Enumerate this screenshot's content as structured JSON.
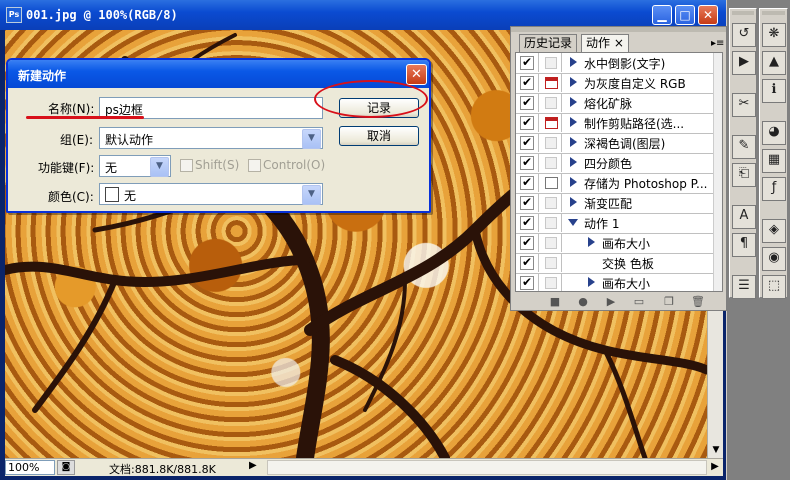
{
  "document": {
    "title": "001.jpg @ 100%(RGB/8)",
    "app_icon_label": "Ps",
    "zoom": "100%",
    "doc_info": "文档:881.8K/881.8K"
  },
  "dialog": {
    "title": "新建动作",
    "name_label": "名称(N):",
    "name_value": "ps边框",
    "group_label": "组(E):",
    "group_value": "默认动作",
    "function_key_label": "功能键(F):",
    "function_key_value": "无",
    "shift_label": "Shift(S)",
    "control_label": "Control(O)",
    "color_label": "颜色(C):",
    "color_value": "无",
    "record_button": "记录",
    "cancel_button": "取消"
  },
  "panel": {
    "tabs": [
      {
        "label": "历史记录"
      },
      {
        "label": "动作",
        "close": "×"
      }
    ],
    "rows": [
      {
        "label": "水中倒影(文字)",
        "checked": true,
        "dialog": false,
        "indent": 0,
        "expanded": false
      },
      {
        "label": "为灰度自定义 RGB",
        "checked": true,
        "dialog": true,
        "indent": 0,
        "expanded": false
      },
      {
        "label": "熔化矿脉",
        "checked": true,
        "dialog": false,
        "indent": 0,
        "expanded": false
      },
      {
        "label": "制作剪贴路径(选...",
        "checked": true,
        "dialog": true,
        "indent": 0,
        "expanded": false
      },
      {
        "label": "深褐色调(图层)",
        "checked": true,
        "dialog": false,
        "indent": 0,
        "expanded": false
      },
      {
        "label": "四分颜色",
        "checked": true,
        "dialog": false,
        "indent": 0,
        "expanded": false
      },
      {
        "label": "存储为 Photoshop P...",
        "checked": true,
        "dialog": true,
        "indent": 0,
        "expanded": false
      },
      {
        "label": "渐变匹配",
        "checked": true,
        "dialog": false,
        "indent": 0,
        "expanded": false
      },
      {
        "label": "动作 1",
        "checked": true,
        "dialog": false,
        "indent": 0,
        "expanded": true
      },
      {
        "label": "画布大小",
        "checked": true,
        "dialog": false,
        "indent": 1,
        "expanded": false
      },
      {
        "label": "交换 色板",
        "checked": true,
        "dialog": false,
        "indent": 1,
        "leaf": true
      },
      {
        "label": "画布大小",
        "checked": true,
        "dialog": false,
        "indent": 1,
        "expanded": false
      }
    ],
    "check_glyph": "✔"
  },
  "colors": {
    "annotation_red": "#d8101a",
    "xp_blue": "#0831d9",
    "triangle_blue": "#27418c"
  }
}
